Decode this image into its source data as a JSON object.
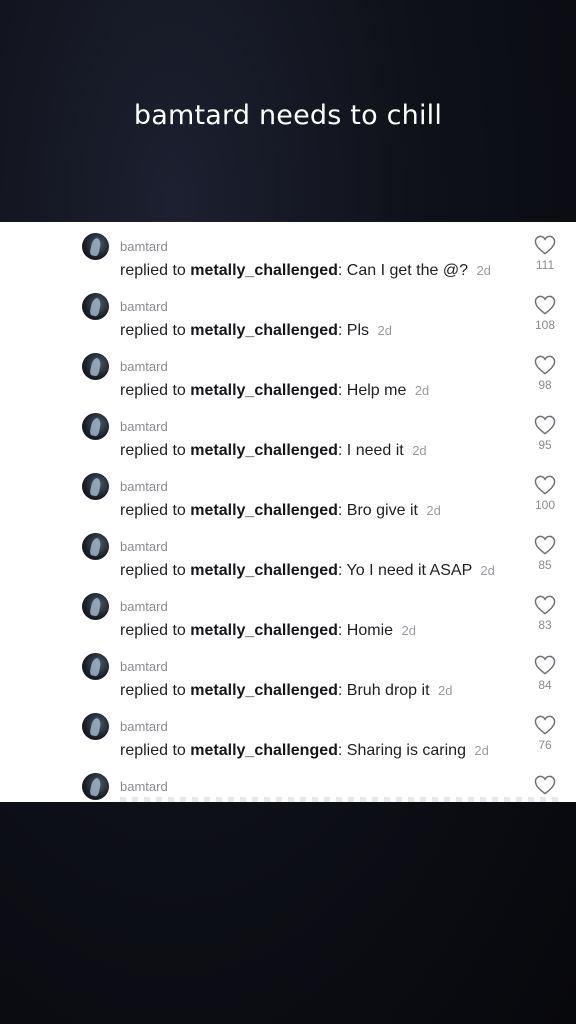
{
  "title": "bamtard needs to chill",
  "reply_prefix": "replied to",
  "comments": [
    {
      "username": "bamtard",
      "reply_to": "metally_challenged",
      "text": "Can I get the @?",
      "age": "2d",
      "likes": "111"
    },
    {
      "username": "bamtard",
      "reply_to": "metally_challenged",
      "text": "Pls",
      "age": "2d",
      "likes": "108"
    },
    {
      "username": "bamtard",
      "reply_to": "metally_challenged",
      "text": "Help me",
      "age": "2d",
      "likes": "98"
    },
    {
      "username": "bamtard",
      "reply_to": "metally_challenged",
      "text": "I need it",
      "age": "2d",
      "likes": "95"
    },
    {
      "username": "bamtard",
      "reply_to": "metally_challenged",
      "text": "Bro give it",
      "age": "2d",
      "likes": "100"
    },
    {
      "username": "bamtard",
      "reply_to": "metally_challenged",
      "text": "Yo I need it ASAP",
      "age": "2d",
      "likes": "85"
    },
    {
      "username": "bamtard",
      "reply_to": "metally_challenged",
      "text": "Homie",
      "age": "2d",
      "likes": "83"
    },
    {
      "username": "bamtard",
      "reply_to": "metally_challenged",
      "text": "Bruh drop it",
      "age": "2d",
      "likes": "84"
    },
    {
      "username": "bamtard",
      "reply_to": "metally_challenged",
      "text": "Sharing is caring",
      "age": "2d",
      "likes": "76"
    },
    {
      "username": "bamtard"
    }
  ],
  "icons": {
    "like": "heart-outline-icon"
  },
  "colors": {
    "background": "#0f1119",
    "panel": "#ffffff",
    "muted_text": "#8a8b91"
  }
}
